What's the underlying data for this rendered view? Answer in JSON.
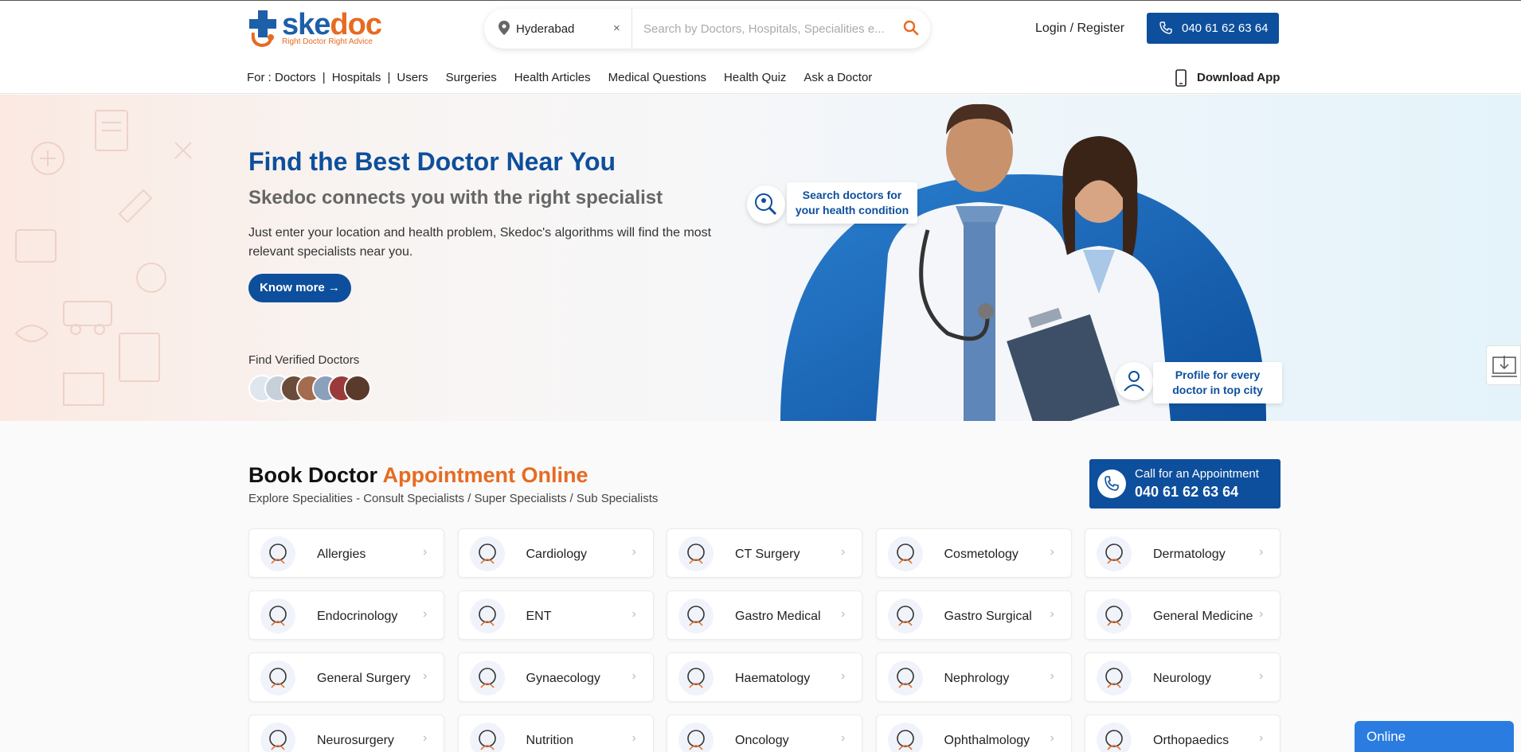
{
  "header": {
    "logo": {
      "part1": "ske",
      "part2": "doc",
      "tagline": "Right Doctor  Right Advice"
    },
    "search": {
      "location": "Hyderabad",
      "clear": "×",
      "placeholder": "Search by Doctors, Hospitals, Specialities e..."
    },
    "login_label": "Login / Register",
    "phone_label": "040 61 62 63 64",
    "nav": {
      "prefix": "For : Doctors",
      "sep": "|",
      "items": [
        "Hospitals",
        "Users",
        "Surgeries",
        "Health Articles",
        "Medical Questions",
        "Health Quiz",
        "Ask a Doctor"
      ]
    },
    "download_label": "Download App"
  },
  "hero": {
    "title": "Find the Best Doctor Near You",
    "subtitle": "Skedoc connects you with the right specialist",
    "description": "Just enter your location and health problem, Skedoc's algorithms will find the most relevant specialists near you.",
    "cta": "Know more →",
    "verified_label": "Find Verified Doctors",
    "badge1": "Search doctors for your health condition",
    "badge2": "Profile for every doctor in top city"
  },
  "specialities": {
    "title_part1": "Book Doctor ",
    "title_part2": "Appointment Online",
    "subtitle": "Explore Specialities - Consult Specialists / Super Specialists / Sub Specialists",
    "call_label": "Call for an Appointment",
    "call_number": "040 61 62 63 64",
    "items": [
      "Allergies",
      "Cardiology",
      "CT Surgery",
      "Cosmetology",
      "Dermatology",
      "Endocrinology",
      "ENT",
      "Gastro Medical",
      "Gastro Surgical",
      "General Medicine",
      "General Surgery",
      "Gynaecology",
      "Haematology",
      "Nephrology",
      "Neurology",
      "Neurosurgery",
      "Nutrition",
      "Oncology",
      "Ophthalmology",
      "Orthopaedics"
    ],
    "chevron": "›"
  },
  "chat": {
    "label": "Online"
  },
  "colors": {
    "brand_blue": "#0d4f9c",
    "brand_orange": "#e66b22",
    "chat_blue": "#2a7ce0"
  },
  "icons": [
    "location-pin-icon",
    "search-icon",
    "phone-icon",
    "mobile-icon",
    "chevron-right-icon",
    "download-icon"
  ]
}
